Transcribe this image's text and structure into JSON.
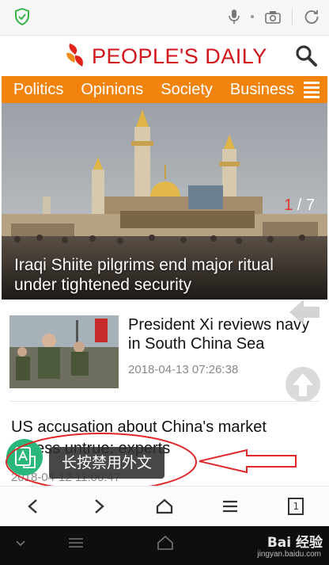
{
  "browser": {
    "icons": [
      "shield-check-icon",
      "microphone-icon",
      "camera-icon",
      "refresh-icon"
    ]
  },
  "masthead": {
    "title": "PEOPLE'S DAILY",
    "brand_color": "#d2141b"
  },
  "nav": {
    "color": "#f2840e",
    "items": [
      {
        "label": "Politics"
      },
      {
        "label": "Opinions"
      },
      {
        "label": "Society"
      },
      {
        "label": "Business"
      }
    ]
  },
  "hero": {
    "counter_current": "1",
    "counter_total": " / 7",
    "caption": "Iraqi Shiite pilgrims end major ritual under tightened security"
  },
  "stories": [
    {
      "title": "President Xi reviews navy in South China Sea",
      "time": "2018-04-13 07:26:38"
    },
    {
      "title": "US accusation about China's market access untrue: experts",
      "time": "2018-04-12 11:00:47"
    }
  ],
  "translate": {
    "tooltip": "长按禁用外文"
  },
  "toolbar": {
    "tab_count": "1",
    "icons": [
      "back-icon",
      "forward-icon",
      "home-icon",
      "menu-icon",
      "tabs-icon"
    ]
  },
  "watermark": {
    "brand": "Bai 经验",
    "domain": "jingyan.baidu.com"
  }
}
